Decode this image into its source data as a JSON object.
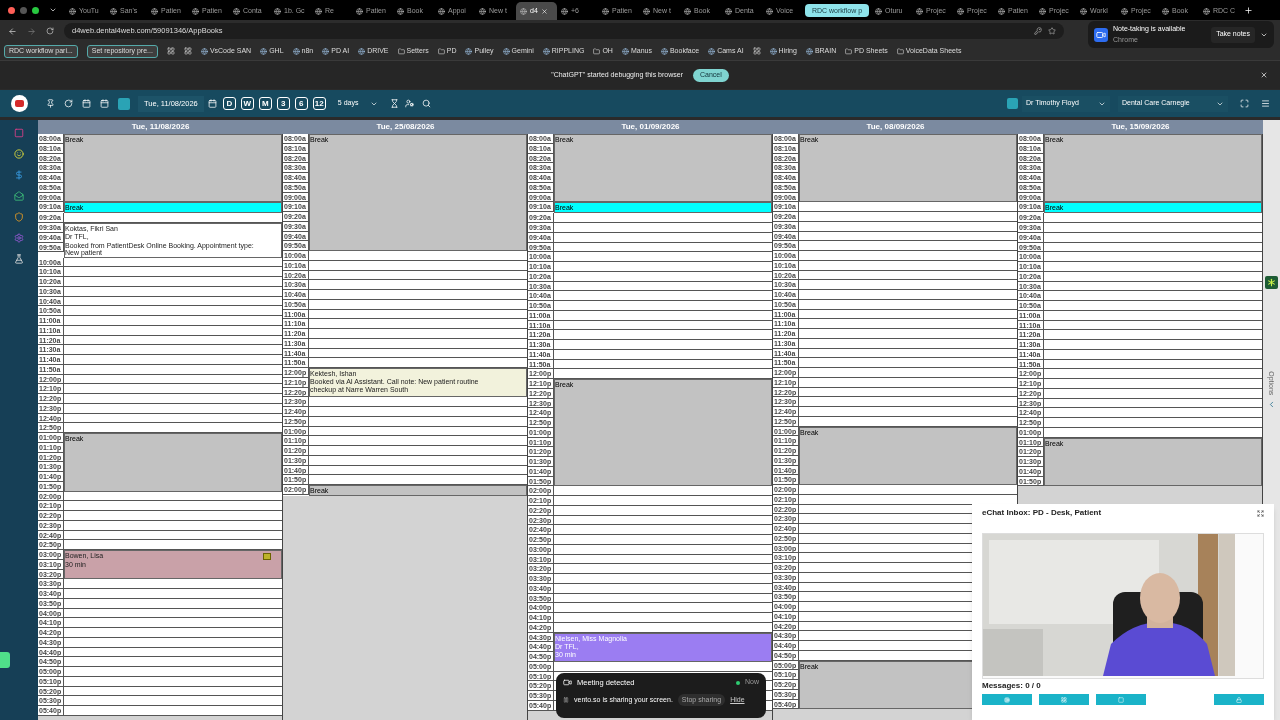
{
  "tabs": [
    {
      "kind": "tab",
      "title": "YouTu",
      "selected": false
    },
    {
      "kind": "tab",
      "title": "San's",
      "selected": false
    },
    {
      "kind": "tab",
      "title": "Patien",
      "selected": false
    },
    {
      "kind": "tab",
      "title": "Patien",
      "selected": false
    },
    {
      "kind": "tab",
      "title": "Conta",
      "selected": false
    },
    {
      "kind": "tab",
      "title": "1b. Gc",
      "selected": false
    },
    {
      "kind": "tab",
      "title": "Re",
      "selected": false
    },
    {
      "kind": "tab",
      "title": "Patien",
      "selected": false
    },
    {
      "kind": "tab",
      "title": "Book",
      "selected": false
    },
    {
      "kind": "tab",
      "title": "Appoi",
      "selected": false
    },
    {
      "kind": "tab",
      "title": "New t",
      "selected": false
    },
    {
      "kind": "tab",
      "title": "d4",
      "selected": true
    },
    {
      "kind": "tab",
      "title": "+6",
      "selected": false
    },
    {
      "kind": "tab",
      "title": "Patien",
      "selected": false
    },
    {
      "kind": "tab",
      "title": "New t",
      "selected": false
    },
    {
      "kind": "tab",
      "title": "Book",
      "selected": false
    },
    {
      "kind": "tab",
      "title": "Denta",
      "selected": false
    },
    {
      "kind": "tab",
      "title": "Voice",
      "selected": false
    },
    {
      "kind": "group",
      "title": "RDC workflow p",
      "selected": false
    },
    {
      "kind": "tab",
      "title": "Oturu",
      "selected": false
    },
    {
      "kind": "tab",
      "title": "Projec",
      "selected": false
    },
    {
      "kind": "tab",
      "title": "Projec",
      "selected": false
    },
    {
      "kind": "tab",
      "title": "Patien",
      "selected": false
    },
    {
      "kind": "tab",
      "title": "Projec",
      "selected": false
    },
    {
      "kind": "tab",
      "title": "Workl",
      "selected": false
    },
    {
      "kind": "tab",
      "title": "Projec",
      "selected": false
    },
    {
      "kind": "tab",
      "title": "Book",
      "selected": false
    },
    {
      "kind": "tab",
      "title": "RDC C",
      "selected": false
    }
  ],
  "url": "d4web.dental4web.com/59091346/AppBooks",
  "bookmarks": [
    {
      "kind": "chip",
      "label": "RDC workflow pari..."
    },
    {
      "kind": "chip",
      "label": "Set repository pre..."
    },
    {
      "kind": "icon"
    },
    {
      "kind": "icon"
    },
    {
      "kind": "link",
      "label": "VsCode SAN"
    },
    {
      "kind": "link",
      "label": "GHL"
    },
    {
      "kind": "link",
      "label": "n8n"
    },
    {
      "kind": "link",
      "label": "PD AI"
    },
    {
      "kind": "link",
      "label": "DRIVE"
    },
    {
      "kind": "folder",
      "label": "Setters"
    },
    {
      "kind": "folder",
      "label": "PD"
    },
    {
      "kind": "link",
      "label": "Pulley"
    },
    {
      "kind": "link",
      "label": "Gemini"
    },
    {
      "kind": "link",
      "label": "RIPPLING"
    },
    {
      "kind": "folder",
      "label": "OH"
    },
    {
      "kind": "link",
      "label": "Manus"
    },
    {
      "kind": "link",
      "label": "Bookface"
    },
    {
      "kind": "link",
      "label": "Cams AI"
    },
    {
      "kind": "icon"
    },
    {
      "kind": "link",
      "label": "Hiring"
    },
    {
      "kind": "link",
      "label": "BRAIN"
    },
    {
      "kind": "folder",
      "label": "PD Sheets"
    },
    {
      "kind": "folder",
      "label": "VoiceData Sheets"
    }
  ],
  "notification": {
    "title": "Note-taking is available",
    "source": "Chrome",
    "action": "Take notes"
  },
  "debug_bar": {
    "message": "\"ChatGPT\" started debugging this browser",
    "cancel": "Cancel"
  },
  "toolbar": {
    "date": "Tue, 11/08/2026",
    "views": [
      "D",
      "W",
      "M",
      "3",
      "6",
      "12"
    ],
    "range": "5 days",
    "provider": "Dr Timothy Floyd",
    "location": "Dental Care Carnegie"
  },
  "side_tab": "Options",
  "columns": [
    {
      "date": "Tue, 11/08/2026",
      "entries": [
        {
          "kind": "break",
          "label": "Break",
          "times": [
            "08:00a",
            "08:10a",
            "08:20a",
            "08:30a",
            "08:40a",
            "08:50a",
            "09:00a"
          ]
        },
        {
          "kind": "highlight",
          "label": "Break",
          "times": [
            "09:10a"
          ]
        },
        {
          "kind": "free",
          "times": [
            "09:20a"
          ]
        },
        {
          "kind": "appointment",
          "color": "#ffffff",
          "note": false,
          "lines": [
            "Koktas, Fikri San",
            "Dr TFL,",
            "Booked from PatientDesk Online Booking. Appointment type: New patient"
          ],
          "times": [
            "09:30a",
            "09:40a",
            "09:50a"
          ]
        },
        {
          "kind": "free",
          "times": [
            "10:00a",
            "10:10a",
            "10:20a",
            "10:30a",
            "10:40a",
            "10:50a",
            "11:00a",
            "11:10a",
            "11:20a",
            "11:30a",
            "11:40a",
            "11:50a",
            "12:00p",
            "12:10p",
            "12:20p",
            "12:30p",
            "12:40p",
            "12:50p"
          ]
        },
        {
          "kind": "break",
          "label": "Break",
          "times": [
            "01:00p",
            "01:10p",
            "01:20p",
            "01:30p",
            "01:40p",
            "01:50p"
          ]
        },
        {
          "kind": "free",
          "times": [
            "02:00p",
            "02:10p",
            "02:20p",
            "02:30p",
            "02:40p",
            "02:50p"
          ]
        },
        {
          "kind": "appointment",
          "color": "#c9a1a8",
          "note": true,
          "lines": [
            "Bowen, Lisa",
            "30 min"
          ],
          "times": [
            "03:00p",
            "03:10p",
            "03:20p"
          ]
        },
        {
          "kind": "free",
          "times": [
            "03:30p",
            "03:40p",
            "03:50p",
            "04:00p",
            "04:10p",
            "04:20p",
            "04:30p",
            "04:40p",
            "04:50p",
            "05:00p",
            "05:10p",
            "05:20p",
            "05:30p",
            "05:40p"
          ]
        }
      ]
    },
    {
      "date": "Tue, 25/08/2026",
      "entries": [
        {
          "kind": "break",
          "label": "Break",
          "times": [
            "08:00a",
            "08:10a",
            "08:20a",
            "08:30a",
            "08:40a",
            "08:50a",
            "09:00a",
            "09:10a",
            "09:20a",
            "09:30a",
            "09:40a",
            "09:50a"
          ]
        },
        {
          "kind": "free",
          "times": [
            "10:00a",
            "10:10a",
            "10:20a",
            "10:30a",
            "10:40a",
            "10:50a",
            "11:00a",
            "11:10a",
            "11:20a",
            "11:30a",
            "11:40a",
            "11:50a"
          ]
        },
        {
          "kind": "appointment",
          "color": "#f2f2dc",
          "note": false,
          "lines": [
            "Kektesh, Ishan",
            "Booked via AI Assistant. Call note: New patient routine checkup at Narre Warren South"
          ],
          "times": [
            "12:00p",
            "12:10p",
            "12:20p"
          ]
        },
        {
          "kind": "free",
          "times": [
            "12:30p",
            "12:40p",
            "12:50p",
            "01:00p",
            "01:10p",
            "01:20p",
            "01:30p",
            "01:40p",
            "01:50p"
          ]
        },
        {
          "kind": "break",
          "label": "Break",
          "times": [
            "02:00p"
          ]
        }
      ]
    },
    {
      "date": "Tue, 01/09/2026",
      "entries": [
        {
          "kind": "break",
          "label": "Break",
          "times": [
            "08:00a",
            "08:10a",
            "08:20a",
            "08:30a",
            "08:40a",
            "08:50a",
            "09:00a"
          ]
        },
        {
          "kind": "highlight",
          "label": "Break",
          "times": [
            "09:10a"
          ]
        },
        {
          "kind": "free",
          "times": [
            "09:20a",
            "09:30a",
            "09:40a",
            "09:50a",
            "10:00a",
            "10:10a",
            "10:20a",
            "10:30a",
            "10:40a",
            "10:50a",
            "11:00a",
            "11:10a",
            "11:20a",
            "11:30a",
            "11:40a",
            "11:50a",
            "12:00p"
          ]
        },
        {
          "kind": "break",
          "label": "Break",
          "times": [
            "12:10p",
            "12:20p",
            "12:30p",
            "12:40p",
            "12:50p",
            "01:00p",
            "01:10p",
            "01:20p",
            "01:30p",
            "01:40p",
            "01:50p"
          ]
        },
        {
          "kind": "free",
          "times": [
            "02:00p",
            "02:10p",
            "02:20p",
            "02:30p",
            "02:40p",
            "02:50p",
            "03:00p",
            "03:10p",
            "03:20p",
            "03:30p",
            "03:40p",
            "03:50p",
            "04:00p",
            "04:10p",
            "04:20p"
          ]
        },
        {
          "kind": "appointment",
          "color": "#9b7df2",
          "note": false,
          "lines": [
            "Nielsen, Miss Magnolia",
            "Dr TFL,",
            "30 min"
          ],
          "times": [
            "04:30p",
            "04:40p",
            "04:50p"
          ]
        },
        {
          "kind": "free",
          "times": [
            "05:00p",
            "05:10p",
            "05:20p",
            "05:30p",
            "05:40p"
          ]
        }
      ]
    },
    {
      "date": "Tue, 08/09/2026",
      "entries": [
        {
          "kind": "break",
          "label": "Break",
          "times": [
            "08:00a",
            "08:10a",
            "08:20a",
            "08:30a",
            "08:40a",
            "08:50a",
            "09:00a"
          ]
        },
        {
          "kind": "free",
          "times": [
            "09:10a",
            "09:20a",
            "09:30a",
            "09:40a",
            "09:50a",
            "10:00a",
            "10:10a",
            "10:20a",
            "10:30a",
            "10:40a",
            "10:50a",
            "11:00a",
            "11:10a",
            "11:20a",
            "11:30a",
            "11:40a",
            "11:50a",
            "12:00p",
            "12:10p",
            "12:20p",
            "12:30p",
            "12:40p",
            "12:50p"
          ]
        },
        {
          "kind": "break",
          "label": "Break",
          "times": [
            "01:00p",
            "01:10p",
            "01:20p",
            "01:30p",
            "01:40p",
            "01:50p"
          ]
        },
        {
          "kind": "free",
          "times": [
            "02:00p",
            "02:10p",
            "02:20p",
            "02:30p",
            "02:40p",
            "02:50p",
            "03:00p",
            "03:10p",
            "03:20p",
            "03:30p",
            "03:40p",
            "03:50p",
            "04:00p",
            "04:10p",
            "04:20p",
            "04:30p",
            "04:40p",
            "04:50p"
          ]
        },
        {
          "kind": "break",
          "label": "Break",
          "times": [
            "05:00p",
            "05:10p",
            "05:20p",
            "05:30p",
            "05:40p"
          ]
        }
      ]
    },
    {
      "date": "Tue, 15/09/2026",
      "entries": [
        {
          "kind": "break",
          "label": "Break",
          "times": [
            "08:00a",
            "08:10a",
            "08:20a",
            "08:30a",
            "08:40a",
            "08:50a",
            "09:00a"
          ]
        },
        {
          "kind": "highlight",
          "label": "Break",
          "times": [
            "09:10a"
          ]
        },
        {
          "kind": "free",
          "times": [
            "09:20a",
            "09:30a",
            "09:40a",
            "09:50a",
            "10:00a",
            "10:10a",
            "10:20a",
            "10:30a",
            "10:40a",
            "10:50a",
            "11:00a",
            "11:10a",
            "11:20a",
            "11:30a",
            "11:40a",
            "11:50a",
            "12:00p",
            "12:10p",
            "12:20p",
            "12:30p",
            "12:40p",
            "12:50p",
            "01:00p"
          ]
        },
        {
          "kind": "break",
          "label": "Break",
          "times": [
            "01:10p",
            "01:20p",
            "01:30p",
            "01:40p",
            "01:50p"
          ]
        }
      ]
    }
  ],
  "meeting": {
    "title": "Meeting detected",
    "time": "Now",
    "message": "vento.so is sharing your screen.",
    "stop": "Stop sharing",
    "hide": "Hide"
  },
  "chat": {
    "title": "eChat Inbox: PD - Desk, Patient",
    "messages": "Messages: 0 / 0"
  }
}
